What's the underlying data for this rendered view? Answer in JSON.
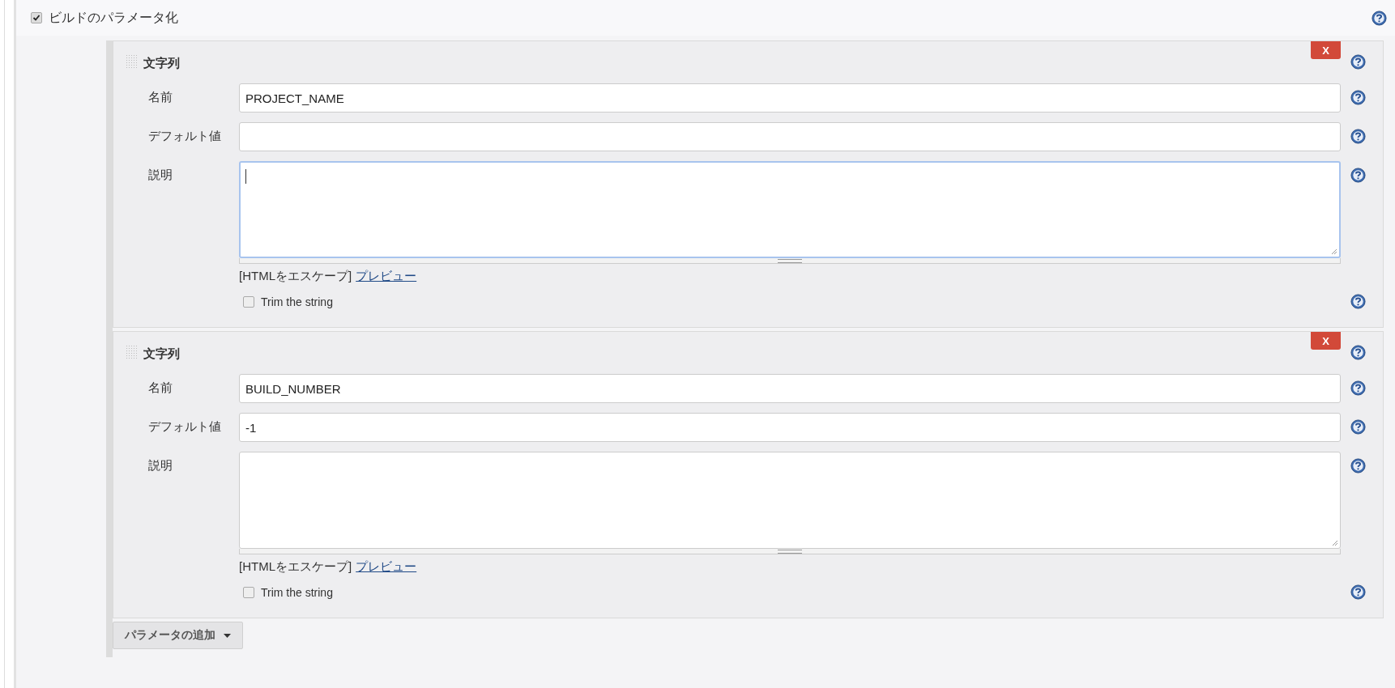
{
  "header": {
    "label": "ビルドのパラメータ化",
    "checked": true
  },
  "parameters": [
    {
      "type_label": "文字列",
      "delete_label": "X",
      "fields": [
        {
          "kind": "text",
          "label": "名前",
          "value": "PROJECT_NAME",
          "focused": false
        },
        {
          "kind": "text",
          "label": "デフォルト値",
          "focused": false
        },
        {
          "kind": "textarea",
          "label": "説明",
          "focused": true
        }
      ],
      "escape_note": "[HTMLをエスケープ]",
      "preview_link": "プレビュー",
      "trim": {
        "label": "Trim the string",
        "checked": false
      }
    },
    {
      "type_label": "文字列",
      "delete_label": "X",
      "fields": [
        {
          "kind": "text",
          "label": "名前",
          "value": "BUILD_NUMBER",
          "focused": false
        },
        {
          "kind": "text",
          "label": "デフォルト値",
          "value": "-1",
          "focused": false
        },
        {
          "kind": "textarea",
          "label": "説明",
          "focused": false
        }
      ],
      "escape_note": "[HTMLをエスケープ]",
      "preview_link": "プレビュー",
      "trim": {
        "label": "Trim the string",
        "checked": false
      }
    }
  ],
  "add_button": {
    "label": "パラメータの追加"
  }
}
